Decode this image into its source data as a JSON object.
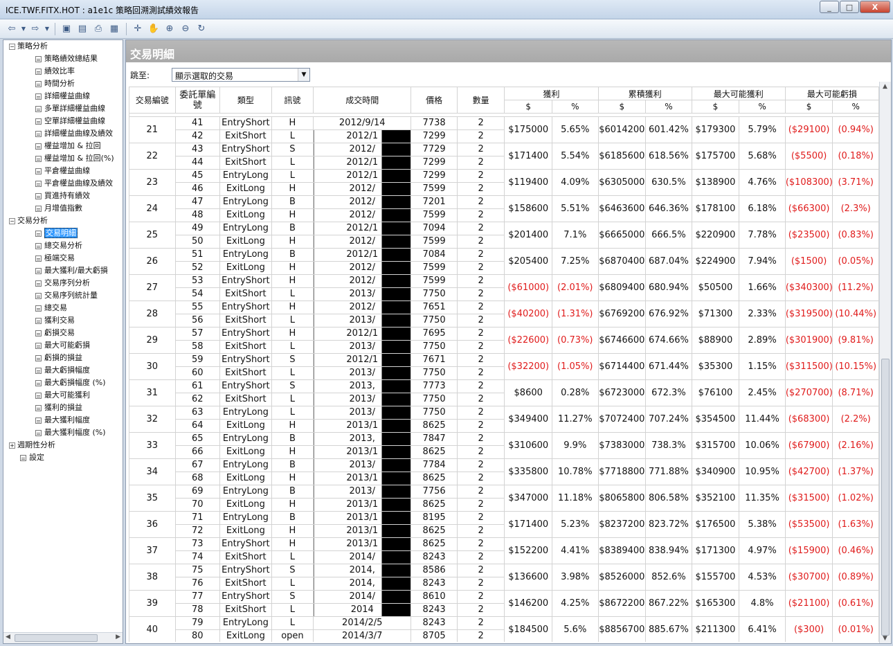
{
  "window": {
    "title": "ICE.TWF.FITX.HOT : a1e1c 策略回溯測試績效報告",
    "min": "_",
    "max": "□",
    "close": "X"
  },
  "toolbar": {
    "icons": [
      "back-icon",
      "back-dropdown-icon",
      "forward-icon",
      "forward-dropdown-icon",
      "save-icon",
      "document-icon",
      "print-icon",
      "options-icon",
      "crosshair-icon",
      "hand-icon",
      "zoom-in-icon",
      "zoom-out-icon",
      "refresh-icon"
    ]
  },
  "sidebar": {
    "groups": [
      {
        "label": "策略分析",
        "expanded": true,
        "items": [
          "策略績效總結果",
          "績效比率",
          "時間分析",
          "詳細權益曲線",
          "多單詳細權益曲線",
          "空單詳細權益曲線",
          "詳細權益曲線及績效",
          "權益增加 & 拉回",
          "權益增加 & 拉回(%)",
          "平倉權益曲線",
          "平倉權益曲線及績效",
          "買進持有績效",
          "月增值指數"
        ]
      },
      {
        "label": "交易分析",
        "expanded": true,
        "items": [
          "交易明細",
          "總交易分析",
          "極端交易",
          "最大獲利/最大虧損",
          "交易序列分析",
          "交易序列統計量",
          "總交易",
          "獲利交易",
          "虧損交易",
          "最大可能虧損",
          "虧損的損益",
          "最大虧損幅度",
          "最大虧損幅度 (%)",
          "最大可能獲利",
          "獲利的損益",
          "最大獲利幅度",
          "最大獲利幅度 (%)"
        ]
      },
      {
        "label": "週期性分析",
        "expanded": false,
        "items": []
      },
      {
        "label": "設定",
        "expanded": false,
        "items": []
      }
    ],
    "selected": "交易明細"
  },
  "main": {
    "header": "交易明細",
    "jump_label": "跳至:",
    "jump_value": "顯示選取的交易",
    "columns": {
      "trade_no": "交易編號",
      "order_no": "委託單編號",
      "type": "類型",
      "signal": "訊號",
      "time": "成交時間",
      "price": "價格",
      "qty": "數量",
      "profit": "獲利",
      "cum_profit": "累積獲利",
      "max_gain": "最大可能獲利",
      "max_loss": "最大可能虧損",
      "dollar": "$",
      "pct": "%"
    },
    "top_partial": {
      "type": "ExitShort",
      "signal": "L",
      "time": "2012/10/12",
      "price": "7299"
    },
    "trades": [
      {
        "n": "21",
        "o1": "41",
        "o2": "42",
        "t1": "EntryShort",
        "t2": "ExitShort",
        "s1": "H",
        "s2": "L",
        "d1": "2012/9/14",
        "d2": "2012/1",
        "p1": "7738",
        "p2": "7299",
        "q1": "2",
        "q2": "2",
        "pd": "$175000",
        "pp": "5.65%",
        "cd": "$6014200",
        "cp": "601.42%",
        "gd": "$179300",
        "gp": "5.79%",
        "ld": "($29100)",
        "lp": "(0.94%)",
        "neg": false
      },
      {
        "n": "22",
        "o1": "43",
        "o2": "44",
        "t1": "EntryShort",
        "t2": "ExitShort",
        "s1": "S",
        "s2": "L",
        "d1": "2012/",
        "d2": "2012/1",
        "p1": "7729",
        "p2": "7299",
        "q1": "2",
        "q2": "2",
        "pd": "$171400",
        "pp": "5.54%",
        "cd": "$6185600",
        "cp": "618.56%",
        "gd": "$175700",
        "gp": "5.68%",
        "ld": "($5500)",
        "lp": "(0.18%)",
        "neg": false
      },
      {
        "n": "23",
        "o1": "45",
        "o2": "46",
        "t1": "EntryLong",
        "t2": "ExitLong",
        "s1": "L",
        "s2": "H",
        "d1": "2012/1",
        "d2": "2012/",
        "p1": "7299",
        "p2": "7599",
        "q1": "2",
        "q2": "2",
        "pd": "$119400",
        "pp": "4.09%",
        "cd": "$6305000",
        "cp": "630.5%",
        "gd": "$138900",
        "gp": "4.76%",
        "ld": "($108300)",
        "lp": "(3.71%)",
        "neg": false
      },
      {
        "n": "24",
        "o1": "47",
        "o2": "48",
        "t1": "EntryLong",
        "t2": "ExitLong",
        "s1": "B",
        "s2": "H",
        "d1": "2012/",
        "d2": "2012/",
        "p1": "7201",
        "p2": "7599",
        "q1": "2",
        "q2": "2",
        "pd": "$158600",
        "pp": "5.51%",
        "cd": "$6463600",
        "cp": "646.36%",
        "gd": "$178100",
        "gp": "6.18%",
        "ld": "($66300)",
        "lp": "(2.3%)",
        "neg": false
      },
      {
        "n": "25",
        "o1": "49",
        "o2": "50",
        "t1": "EntryLong",
        "t2": "ExitLong",
        "s1": "B",
        "s2": "H",
        "d1": "2012/1",
        "d2": "2012/",
        "p1": "7094",
        "p2": "7599",
        "q1": "2",
        "q2": "2",
        "pd": "$201400",
        "pp": "7.1%",
        "cd": "$6665000",
        "cp": "666.5%",
        "gd": "$220900",
        "gp": "7.78%",
        "ld": "($23500)",
        "lp": "(0.83%)",
        "neg": false
      },
      {
        "n": "26",
        "o1": "51",
        "o2": "52",
        "t1": "EntryLong",
        "t2": "ExitLong",
        "s1": "B",
        "s2": "H",
        "d1": "2012/1",
        "d2": "2012/",
        "p1": "7084",
        "p2": "7599",
        "q1": "2",
        "q2": "2",
        "pd": "$205400",
        "pp": "7.25%",
        "cd": "$6870400",
        "cp": "687.04%",
        "gd": "$224900",
        "gp": "7.94%",
        "ld": "($1500)",
        "lp": "(0.05%)",
        "neg": false
      },
      {
        "n": "27",
        "o1": "53",
        "o2": "54",
        "t1": "EntryShort",
        "t2": "ExitShort",
        "s1": "H",
        "s2": "L",
        "d1": "2012/",
        "d2": "2013/",
        "p1": "7599",
        "p2": "7750",
        "q1": "2",
        "q2": "2",
        "pd": "($61000)",
        "pp": "(2.01%)",
        "cd": "$6809400",
        "cp": "680.94%",
        "gd": "$50500",
        "gp": "1.66%",
        "ld": "($340300)",
        "lp": "(11.2%)",
        "neg": true
      },
      {
        "n": "28",
        "o1": "55",
        "o2": "56",
        "t1": "EntryShort",
        "t2": "ExitShort",
        "s1": "H",
        "s2": "L",
        "d1": "2012/",
        "d2": "2013/",
        "p1": "7651",
        "p2": "7750",
        "q1": "2",
        "q2": "2",
        "pd": "($40200)",
        "pp": "(1.31%)",
        "cd": "$6769200",
        "cp": "676.92%",
        "gd": "$71300",
        "gp": "2.33%",
        "ld": "($319500)",
        "lp": "(10.44%)",
        "neg": true
      },
      {
        "n": "29",
        "o1": "57",
        "o2": "58",
        "t1": "EntryShort",
        "t2": "ExitShort",
        "s1": "H",
        "s2": "L",
        "d1": "2012/1",
        "d2": "2013/",
        "p1": "7695",
        "p2": "7750",
        "q1": "2",
        "q2": "2",
        "pd": "($22600)",
        "pp": "(0.73%)",
        "cd": "$6746600",
        "cp": "674.66%",
        "gd": "$88900",
        "gp": "2.89%",
        "ld": "($301900)",
        "lp": "(9.81%)",
        "neg": true
      },
      {
        "n": "30",
        "o1": "59",
        "o2": "60",
        "t1": "EntryShort",
        "t2": "ExitShort",
        "s1": "S",
        "s2": "L",
        "d1": "2012/1",
        "d2": "2013/",
        "p1": "7671",
        "p2": "7750",
        "q1": "2",
        "q2": "2",
        "pd": "($32200)",
        "pp": "(1.05%)",
        "cd": "$6714400",
        "cp": "671.44%",
        "gd": "$35300",
        "gp": "1.15%",
        "ld": "($311500)",
        "lp": "(10.15%)",
        "neg": true
      },
      {
        "n": "31",
        "o1": "61",
        "o2": "62",
        "t1": "EntryShort",
        "t2": "ExitShort",
        "s1": "S",
        "s2": "L",
        "d1": "2013,",
        "d2": "2013/",
        "p1": "7773",
        "p2": "7750",
        "q1": "2",
        "q2": "2",
        "pd": "$8600",
        "pp": "0.28%",
        "cd": "$6723000",
        "cp": "672.3%",
        "gd": "$76100",
        "gp": "2.45%",
        "ld": "($270700)",
        "lp": "(8.71%)",
        "neg": false
      },
      {
        "n": "32",
        "o1": "63",
        "o2": "64",
        "t1": "EntryLong",
        "t2": "ExitLong",
        "s1": "L",
        "s2": "H",
        "d1": "2013/",
        "d2": "2013/1",
        "p1": "7750",
        "p2": "8625",
        "q1": "2",
        "q2": "2",
        "pd": "$349400",
        "pp": "11.27%",
        "cd": "$7072400",
        "cp": "707.24%",
        "gd": "$354500",
        "gp": "11.44%",
        "ld": "($68300)",
        "lp": "(2.2%)",
        "neg": false
      },
      {
        "n": "33",
        "o1": "65",
        "o2": "66",
        "t1": "EntryLong",
        "t2": "ExitLong",
        "s1": "B",
        "s2": "H",
        "d1": "2013,",
        "d2": "2013/1",
        "p1": "7847",
        "p2": "8625",
        "q1": "2",
        "q2": "2",
        "pd": "$310600",
        "pp": "9.9%",
        "cd": "$7383000",
        "cp": "738.3%",
        "gd": "$315700",
        "gp": "10.06%",
        "ld": "($67900)",
        "lp": "(2.16%)",
        "neg": false
      },
      {
        "n": "34",
        "o1": "67",
        "o2": "68",
        "t1": "EntryLong",
        "t2": "ExitLong",
        "s1": "B",
        "s2": "H",
        "d1": "2013/",
        "d2": "2013/1",
        "p1": "7784",
        "p2": "8625",
        "q1": "2",
        "q2": "2",
        "pd": "$335800",
        "pp": "10.78%",
        "cd": "$7718800",
        "cp": "771.88%",
        "gd": "$340900",
        "gp": "10.95%",
        "ld": "($42700)",
        "lp": "(1.37%)",
        "neg": false
      },
      {
        "n": "35",
        "o1": "69",
        "o2": "70",
        "t1": "EntryLong",
        "t2": "ExitLong",
        "s1": "B",
        "s2": "H",
        "d1": "2013/",
        "d2": "2013/1",
        "p1": "7756",
        "p2": "8625",
        "q1": "2",
        "q2": "2",
        "pd": "$347000",
        "pp": "11.18%",
        "cd": "$8065800",
        "cp": "806.58%",
        "gd": "$352100",
        "gp": "11.35%",
        "ld": "($31500)",
        "lp": "(1.02%)",
        "neg": false
      },
      {
        "n": "36",
        "o1": "71",
        "o2": "72",
        "t1": "EntryLong",
        "t2": "ExitLong",
        "s1": "B",
        "s2": "H",
        "d1": "2013/1",
        "d2": "2013/1",
        "p1": "8195",
        "p2": "8625",
        "q1": "2",
        "q2": "2",
        "pd": "$171400",
        "pp": "5.23%",
        "cd": "$8237200",
        "cp": "823.72%",
        "gd": "$176500",
        "gp": "5.38%",
        "ld": "($53500)",
        "lp": "(1.63%)",
        "neg": false
      },
      {
        "n": "37",
        "o1": "73",
        "o2": "74",
        "t1": "EntryShort",
        "t2": "ExitShort",
        "s1": "H",
        "s2": "L",
        "d1": "2013/1",
        "d2": "2014/",
        "p1": "8625",
        "p2": "8243",
        "q1": "2",
        "q2": "2",
        "pd": "$152200",
        "pp": "4.41%",
        "cd": "$8389400",
        "cp": "838.94%",
        "gd": "$171300",
        "gp": "4.97%",
        "ld": "($15900)",
        "lp": "(0.46%)",
        "neg": false
      },
      {
        "n": "38",
        "o1": "75",
        "o2": "76",
        "t1": "EntryShort",
        "t2": "ExitShort",
        "s1": "S",
        "s2": "L",
        "d1": "2014,",
        "d2": "2014,",
        "p1": "8586",
        "p2": "8243",
        "q1": "2",
        "q2": "2",
        "pd": "$136600",
        "pp": "3.98%",
        "cd": "$8526000",
        "cp": "852.6%",
        "gd": "$155700",
        "gp": "4.53%",
        "ld": "($30700)",
        "lp": "(0.89%)",
        "neg": false
      },
      {
        "n": "39",
        "o1": "77",
        "o2": "78",
        "t1": "EntryShort",
        "t2": "ExitShort",
        "s1": "S",
        "s2": "L",
        "d1": "2014/",
        "d2": "2014",
        "p1": "8610",
        "p2": "8243",
        "q1": "2",
        "q2": "2",
        "pd": "$146200",
        "pp": "4.25%",
        "cd": "$8672200",
        "cp": "867.22%",
        "gd": "$165300",
        "gp": "4.8%",
        "ld": "($21100)",
        "lp": "(0.61%)",
        "neg": false
      },
      {
        "n": "40",
        "o1": "79",
        "o2": "80",
        "t1": "EntryLong",
        "t2": "ExitLong",
        "s1": "L",
        "s2": "open",
        "d1": "2014/2/5",
        "d2": "2014/3/7",
        "p1": "8243",
        "p2": "8705",
        "q1": "2",
        "q2": "2",
        "pd": "$184500",
        "pp": "5.6%",
        "cd": "$8856700",
        "cp": "885.67%",
        "gd": "$211300",
        "gp": "6.41%",
        "ld": "($300)",
        "lp": "(0.01%)",
        "neg": false
      }
    ]
  },
  "colors": {
    "header_bg": "#a9a9a9",
    "negative": "#e01b1b",
    "selection": "#3399ff"
  }
}
